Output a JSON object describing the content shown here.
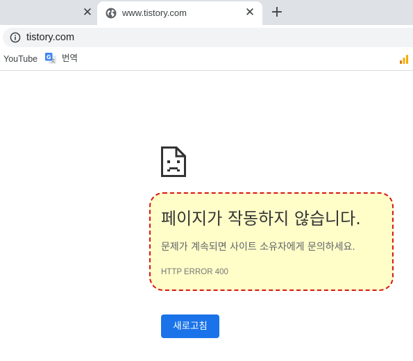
{
  "tabs": [
    {
      "title": "",
      "close_label": "✕"
    },
    {
      "title": "www.tistory.com",
      "close_label": "✕",
      "icon": "globe-icon"
    }
  ],
  "new_tab_label": "+",
  "omnibox": {
    "url": "tistory.com",
    "icon": "info-icon"
  },
  "bookmarks": [
    {
      "label": "YouTube"
    },
    {
      "label": "번역",
      "icon": "google-translate-icon"
    }
  ],
  "extension_icon": "signal-bars-icon",
  "error_page": {
    "icon": "sad-page-icon",
    "heading": "페이지가 작동하지 않습니다.",
    "message": "문제가 계속되면 사이트 소유자에게 문의하세요.",
    "error_code": "HTTP ERROR 400",
    "reload_label": "새로고침"
  },
  "colors": {
    "highlight_fill": "#fffec9",
    "highlight_border": "#d81414",
    "button_blue": "#1a73e8",
    "tabstrip": "#dee1e6"
  }
}
